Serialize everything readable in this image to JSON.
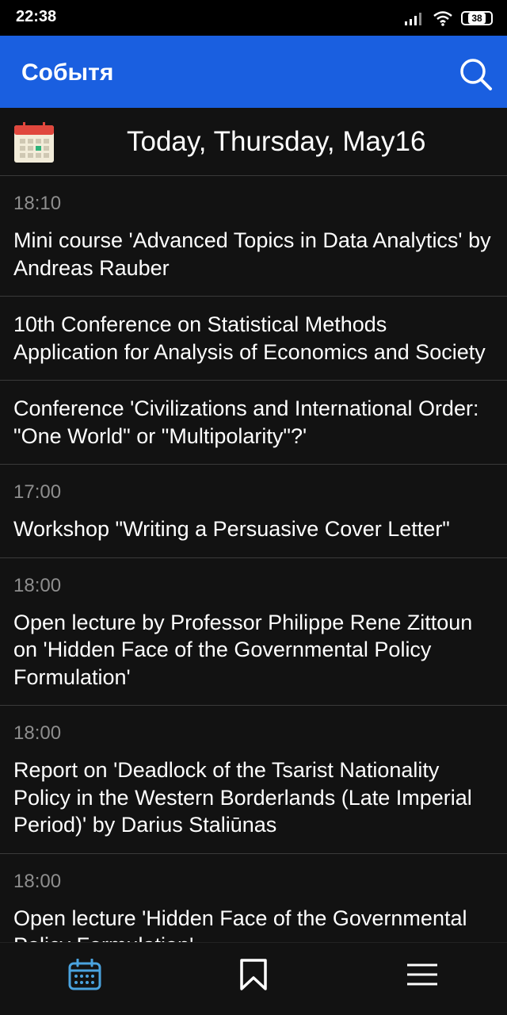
{
  "status_bar": {
    "time": "22:38",
    "battery": "38",
    "icons": [
      "signal-icon",
      "wifi-icon",
      "battery-icon"
    ]
  },
  "app_bar": {
    "title": "Событя",
    "search_icon": "search-icon"
  },
  "date_header": {
    "icon": "calendar-icon",
    "text": "Today, Thursday, May16"
  },
  "events": [
    {
      "time": "18:10",
      "title": "Mini course 'Advanced Topics in Data Analytics' by Andreas Rauber"
    },
    {
      "time": "",
      "title": "10th Conference on Statistical Methods Application for Analysis of Economics and Society"
    },
    {
      "time": "",
      "title": "Conference 'Civilizations and International Order: \"One World\" or \"Multipolarity\"?'"
    },
    {
      "time": "17:00",
      "title": "Workshop \"Writing a Persuasive Cover Letter\""
    },
    {
      "time": "18:00",
      "title": "Open lecture by Professor Philippe Rene Zittoun on 'Hidden Face of the Governmental Policy Formulation'"
    },
    {
      "time": "18:00",
      "title": "Report on 'Deadlock of the Tsarist Nationality Policy in the Western Borderlands (Late Imperial Period)' by Darius Staliūnas"
    },
    {
      "time": "18:00",
      "title": "Open lecture 'Hidden Face of the Governmental Policy Formulation'"
    }
  ],
  "bottom_nav": {
    "items": [
      "calendar-icon",
      "bookmark-icon",
      "menu-icon"
    ],
    "active_color": "#4aa3df"
  }
}
